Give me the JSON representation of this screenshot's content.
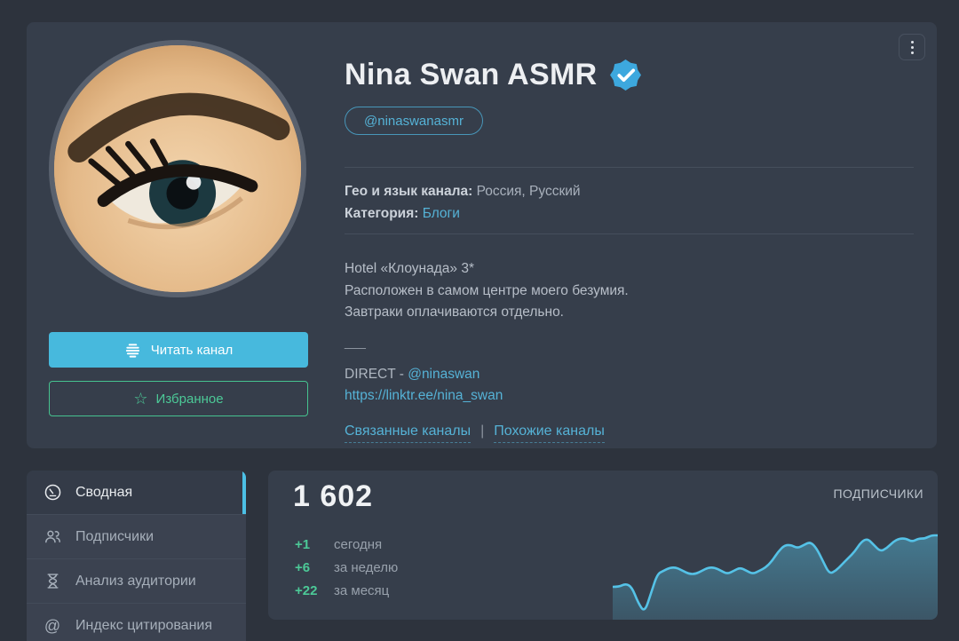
{
  "profile": {
    "title": "Nina Swan ASMR",
    "username": "@ninaswanasmr",
    "geo_label": "Гео и язык канала:",
    "geo_value": "Россия, Русский",
    "category_label": "Категория:",
    "category_value": "Блоги",
    "description_lines": [
      "Hotel «Клоунада» 3*",
      "Расположен в самом центре моего безумия.",
      "Завтраки оплачиваются отдельно."
    ],
    "separator": "___",
    "direct_label": "DIRECT - ",
    "direct_link": "@ninaswan",
    "external_link": "https://linktr.ee/nina_swan",
    "related_link": "Связанные каналы",
    "links_divider": "|",
    "similar_link": "Похожие каналы",
    "read_button": "Читать канал",
    "favorite_button": "Избранное",
    "favorite_icon": "☆",
    "verified_badge": "verified",
    "badge_color": "#3da8de"
  },
  "sidebar": {
    "items": [
      {
        "label": "Сводная",
        "icon": "gauge-icon",
        "active": true
      },
      {
        "label": "Подписчики",
        "icon": "users-icon",
        "active": false
      },
      {
        "label": "Анализ аудитории",
        "icon": "hourglass-icon",
        "active": false
      },
      {
        "label": "Индекс цитирования",
        "icon": "at-icon",
        "active": false
      }
    ]
  },
  "summary": {
    "subscribers_total": "1 602",
    "card_label": "ПОДПИСЧИКИ",
    "stats": [
      {
        "delta": "+1",
        "period": "сегодня"
      },
      {
        "delta": "+6",
        "period": "за неделю"
      },
      {
        "delta": "+22",
        "period": "за месяц"
      }
    ]
  },
  "chart_data": {
    "type": "area",
    "title": "ПОДПИСЧИКИ",
    "series_name": "Подписчики",
    "xlabel": "",
    "ylabel": "",
    "axes_visible": false,
    "grid": false,
    "legend_position": "none",
    "line_color": "#55c2e7",
    "fill_color": "rgba(80,170,200,0.45)",
    "current_value": 1602,
    "approx_value_range": [
      1578,
      1602
    ],
    "values": [
      1586,
      1586,
      1587,
      1586,
      1581,
      1578,
      1584,
      1590,
      1591,
      1592,
      1592,
      1591,
      1590,
      1590,
      1591,
      1592,
      1592,
      1591,
      1590,
      1591,
      1592,
      1591,
      1590,
      1591,
      1592,
      1594,
      1597,
      1599,
      1599,
      1598,
      1599,
      1600,
      1598,
      1594,
      1590,
      1591,
      1593,
      1595,
      1597,
      1600,
      1601,
      1599,
      1597,
      1598,
      1600,
      1601,
      1601,
      1600,
      1601,
      1601,
      1602,
      1602
    ]
  },
  "colors": {
    "page_bg": "#2d333d",
    "card_bg": "#363e4b",
    "accent_cyan": "#47b9dd",
    "accent_green": "#4cc997",
    "sidebar_active_bar": "#4cc0e5"
  }
}
